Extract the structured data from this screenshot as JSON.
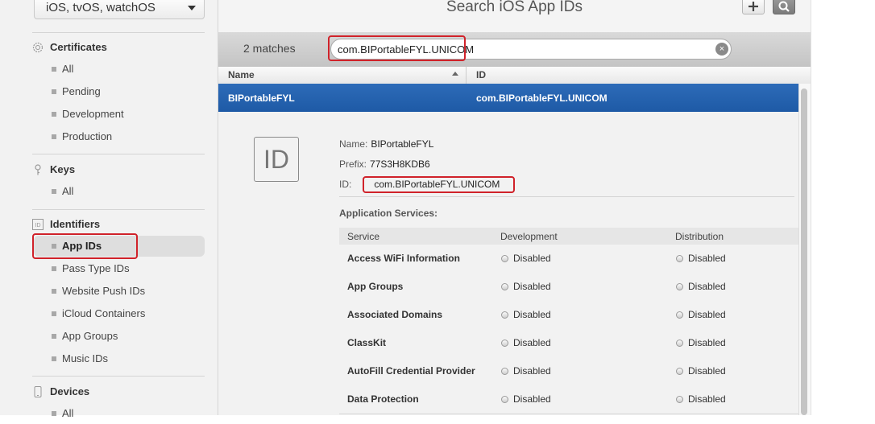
{
  "platform_select": {
    "value": "iOS, tvOS, watchOS"
  },
  "sidebar": {
    "sections": [
      {
        "title": "Certificates",
        "icon": "certificate-icon",
        "items": [
          "All",
          "Pending",
          "Development",
          "Production"
        ]
      },
      {
        "title": "Keys",
        "icon": "key-icon",
        "items": [
          "All"
        ]
      },
      {
        "title": "Identifiers",
        "icon": "id-icon",
        "items": [
          "App IDs",
          "Pass Type IDs",
          "Website Push IDs",
          "iCloud Containers",
          "App Groups",
          "Music IDs"
        ]
      },
      {
        "title": "Devices",
        "icon": "device-icon",
        "items": [
          "All"
        ]
      }
    ],
    "selected_item": "App IDs"
  },
  "header": {
    "title": "Search iOS App IDs",
    "add_icon": "plus-icon",
    "search_icon": "search-icon"
  },
  "search": {
    "matches": "2 matches",
    "value": "com.BIPortableFYL.UNICOM",
    "clear_glyph": "×"
  },
  "table": {
    "columns": [
      "Name",
      "ID"
    ],
    "selected_row": {
      "name": "BIPortableFYL",
      "id": "com.BIPortableFYL.UNICOM"
    }
  },
  "detail": {
    "badge": "ID",
    "name_label": "Name:",
    "name_value": "BIPortableFYL",
    "prefix_label": "Prefix:",
    "prefix_value": "77S3H8KDB6",
    "id_label": "ID:",
    "id_value": "com.BIPortableFYL.UNICOM",
    "services_title": "Application Services:",
    "services_headers": [
      "Service",
      "Development",
      "Distribution"
    ],
    "services": [
      {
        "name": "Access WiFi Information",
        "development": "Disabled",
        "distribution": "Disabled"
      },
      {
        "name": "App Groups",
        "development": "Disabled",
        "distribution": "Disabled"
      },
      {
        "name": "Associated Domains",
        "development": "Disabled",
        "distribution": "Disabled"
      },
      {
        "name": "ClassKit",
        "development": "Disabled",
        "distribution": "Disabled"
      },
      {
        "name": "AutoFill Credential Provider",
        "development": "Disabled",
        "distribution": "Disabled"
      },
      {
        "name": "Data Protection",
        "development": "Disabled",
        "distribution": "Disabled"
      }
    ]
  },
  "colors": {
    "selection": "#1e5aa6",
    "highlight_box": "#d0222a"
  }
}
